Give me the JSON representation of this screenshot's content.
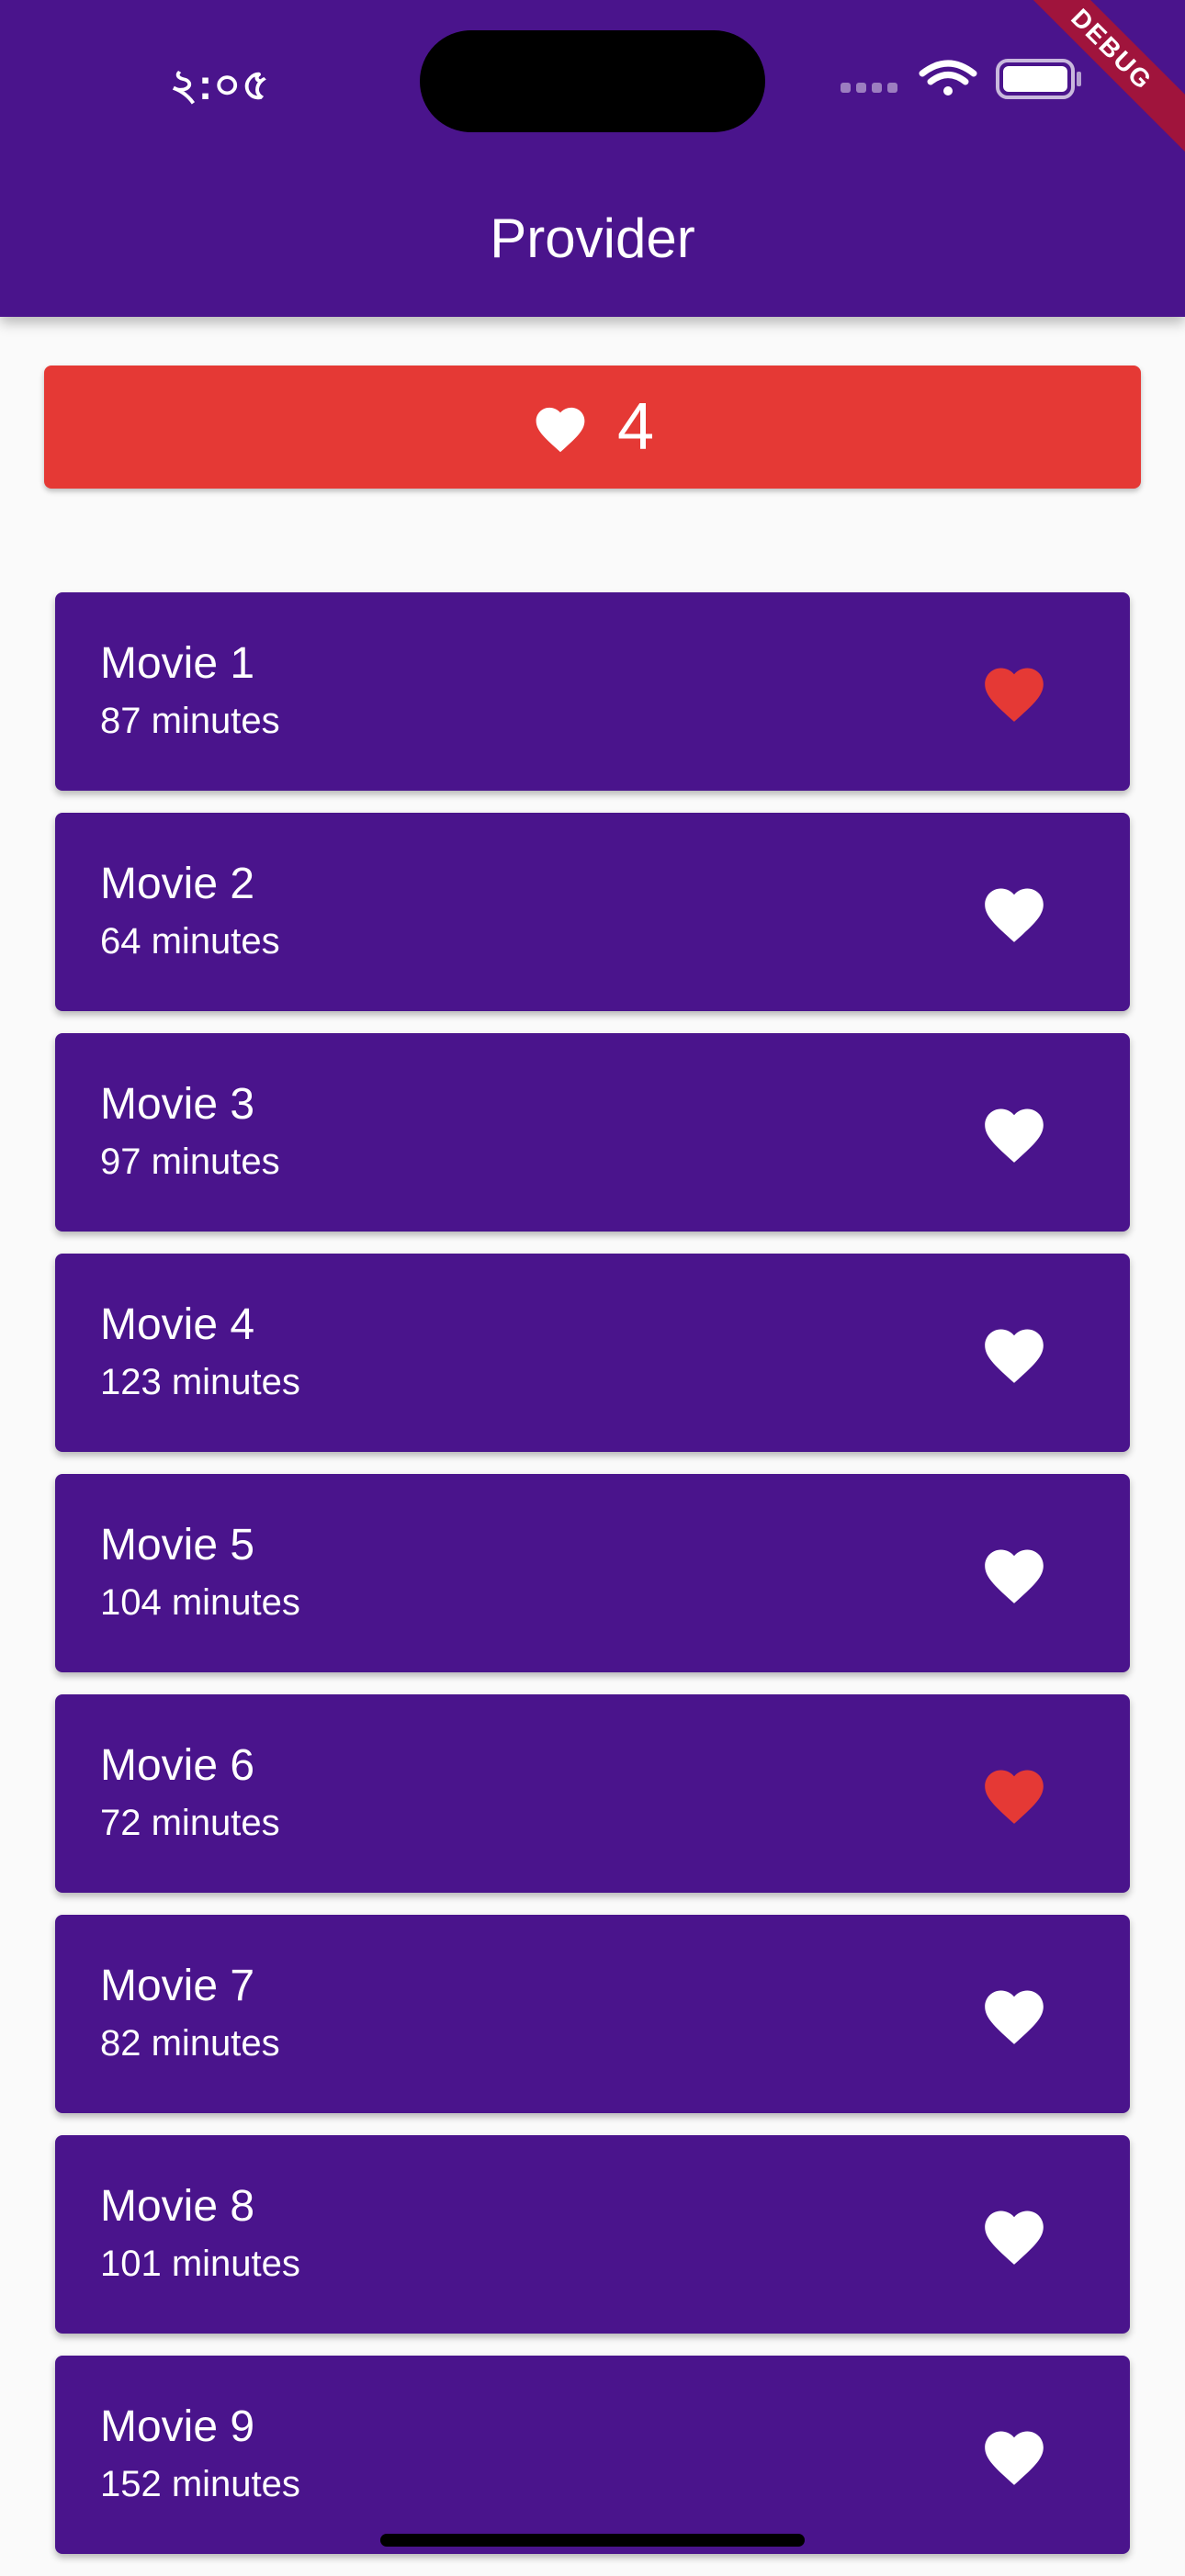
{
  "status_bar": {
    "time": "২:০৫"
  },
  "app_bar": {
    "title": "Provider",
    "debug_label": "DEBUG"
  },
  "favorites_bar": {
    "icon": "heart-icon",
    "count": "4"
  },
  "movies": [
    {
      "title": "Movie 1",
      "duration": "87 minutes",
      "favorite": true
    },
    {
      "title": "Movie 2",
      "duration": "64 minutes",
      "favorite": false
    },
    {
      "title": "Movie 3",
      "duration": "97 minutes",
      "favorite": false
    },
    {
      "title": "Movie 4",
      "duration": "123 minutes",
      "favorite": false
    },
    {
      "title": "Movie 5",
      "duration": "104 minutes",
      "favorite": false
    },
    {
      "title": "Movie 6",
      "duration": "72 minutes",
      "favorite": true
    },
    {
      "title": "Movie 7",
      "duration": "82 minutes",
      "favorite": false
    },
    {
      "title": "Movie 8",
      "duration": "101 minutes",
      "favorite": false
    },
    {
      "title": "Movie 9",
      "duration": "152 minutes",
      "favorite": false
    }
  ],
  "colors": {
    "primary": "#4a148c",
    "accent": "#e53935",
    "heart_inactive": "#ffffff",
    "background": "#fafafa"
  }
}
